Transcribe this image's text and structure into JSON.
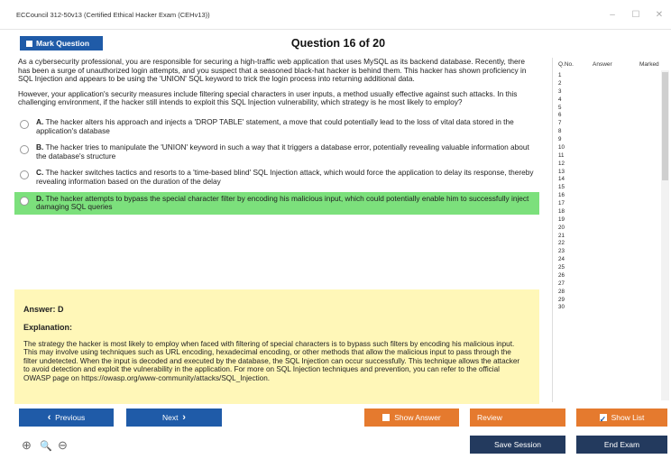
{
  "window": {
    "title": "ECCouncil 312-50v13 (Certified Ethical Hacker Exam (CEHv13))",
    "minimize": "–",
    "maximize": "☐",
    "close": "✕"
  },
  "toolbar": {
    "mark_label": "Mark Question",
    "question_title": "Question 16 of 20"
  },
  "question": {
    "paragraph1": "As a cybersecurity professional, you are responsible for securing a high-traffic web application that uses MySQL as its backend database. Recently, there has been a surge of unauthorized login attempts, and you suspect that a seasoned black-hat hacker is behind them. This hacker has shown proficiency in SQL Injection and appears to be using the 'UNION' SQL keyword to trick the login process into returning additional data.",
    "paragraph2": "However, your application's security measures include filtering special characters in user inputs, a method usually effective against such attacks. In this challenging environment, if the hacker still intends to exploit this SQL Injection vulnerability, which strategy is he most likely to employ?",
    "options": [
      {
        "letter": "A.",
        "text": "The hacker alters his approach and injects a 'DROP TABLE' statement, a move that could potentially lead to the loss of vital data stored in the application's database"
      },
      {
        "letter": "B.",
        "text": "The hacker tries to manipulate the 'UNION' keyword in such a way that it triggers a database error, potentially revealing valuable information about the database's structure"
      },
      {
        "letter": "C.",
        "text": "The hacker switches tactics and resorts to a 'time-based blind' SQL Injection attack, which would force the application to delay its response, thereby revealing information based on the duration of the delay"
      },
      {
        "letter": "D.",
        "text": "The hacker attempts to bypass the special character filter by encoding his malicious input, which could potentially enable him to successfully inject damaging SQL queries"
      }
    ]
  },
  "answer": {
    "answer_label": "Answer: D",
    "explanation_label": "Explanation:",
    "explanation_text": "The strategy the hacker is most likely to employ when faced with filtering of special characters is to bypass such filters by encoding his malicious input. This may involve using techniques such as URL encoding, hexadecimal encoding, or other methods that allow the malicious input to pass through the filter undetected. When the input is decoded and executed by the database, the SQL Injection can occur successfully. This technique allows the attacker to avoid detection and exploit the vulnerability in the application. For more on SQL Injection techniques and prevention, you can refer to the official OWASP page on https://owasp.org/www-community/attacks/SQL_Injection."
  },
  "sidebar": {
    "col_qno": "Q.No.",
    "col_answer": "Answer",
    "col_marked": "Marked",
    "rows": [
      "1",
      "2",
      "3",
      "4",
      "5",
      "6",
      "7",
      "8",
      "9",
      "10",
      "11",
      "12",
      "13",
      "14",
      "15",
      "16",
      "17",
      "18",
      "19",
      "20",
      "21",
      "22",
      "23",
      "24",
      "25",
      "26",
      "27",
      "28",
      "29",
      "30"
    ]
  },
  "buttons": {
    "previous": "Previous",
    "next": "Next",
    "show_answer": "Show Answer",
    "review": "Review",
    "show_list": "Show List",
    "save_session": "Save Session",
    "end_exam": "End Exam"
  },
  "zoom": {
    "zoom_in": "⊕",
    "zoom_reset": "🔍",
    "zoom_out": "⊖"
  },
  "colors": {
    "primary_blue": "#1f5ba8",
    "orange": "#e57a2e",
    "navy": "#233a5e",
    "correct_green": "#7ce07c",
    "answer_yellow": "#fff7b8"
  }
}
